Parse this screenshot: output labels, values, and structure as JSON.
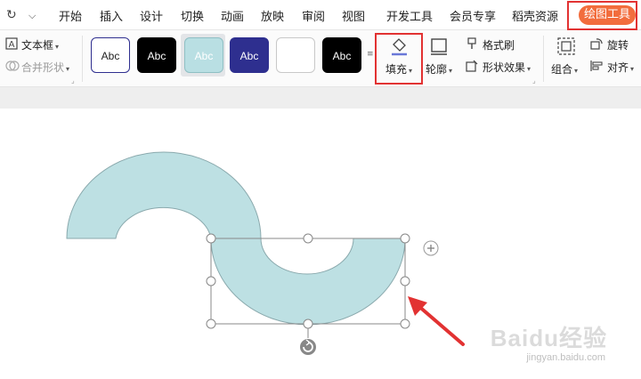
{
  "quick_access": {
    "redo_icon": "redo-icon",
    "dropdown_icon": "chevron-down-icon"
  },
  "menu_tabs": [
    {
      "label": "开始"
    },
    {
      "label": "插入"
    },
    {
      "label": "设计"
    },
    {
      "label": "切换"
    },
    {
      "label": "动画"
    },
    {
      "label": "放映"
    },
    {
      "label": "审阅"
    },
    {
      "label": "视图"
    },
    {
      "label": "开发工具"
    },
    {
      "label": "会员专享"
    },
    {
      "label": "稻壳资源"
    }
  ],
  "active_tab": {
    "label": "绘图工具",
    "color": "#f26d3d"
  },
  "ribbon": {
    "text_box": "文本框",
    "merge_shapes": "合并形状",
    "style_swatches": [
      {
        "label": "Abc",
        "bg": "#ffffff",
        "fg": "#222222",
        "border": "#2f2f8f"
      },
      {
        "label": "Abc",
        "bg": "#000000",
        "fg": "#ffffff",
        "border": "#000000"
      },
      {
        "label": "Abc",
        "bg": "#b9dfe3",
        "fg": "#ffffff",
        "border": "#8fbfc4"
      },
      {
        "label": "Abc",
        "bg": "#2e2f8f",
        "fg": "#ffffff",
        "border": "#2e2f8f"
      },
      {
        "label": "",
        "bg": "#ffffff",
        "fg": "#222222",
        "border": "#c8c8c8"
      },
      {
        "label": "Abc",
        "bg": "#000000",
        "fg": "#ffffff",
        "border": "#000000"
      }
    ],
    "fill": "填充",
    "outline": "轮廓",
    "format_painter": "格式刷",
    "shape_effects": "形状效果",
    "group": "组合",
    "rotate": "旋转",
    "align": "对齐"
  },
  "shape": {
    "fill_color": "#bde0e3",
    "stroke_color": "#8aa9ad"
  },
  "highlight_color": "#e23232",
  "watermark": {
    "brand": "Baidu经验",
    "url": "jingyan.baidu.com"
  }
}
